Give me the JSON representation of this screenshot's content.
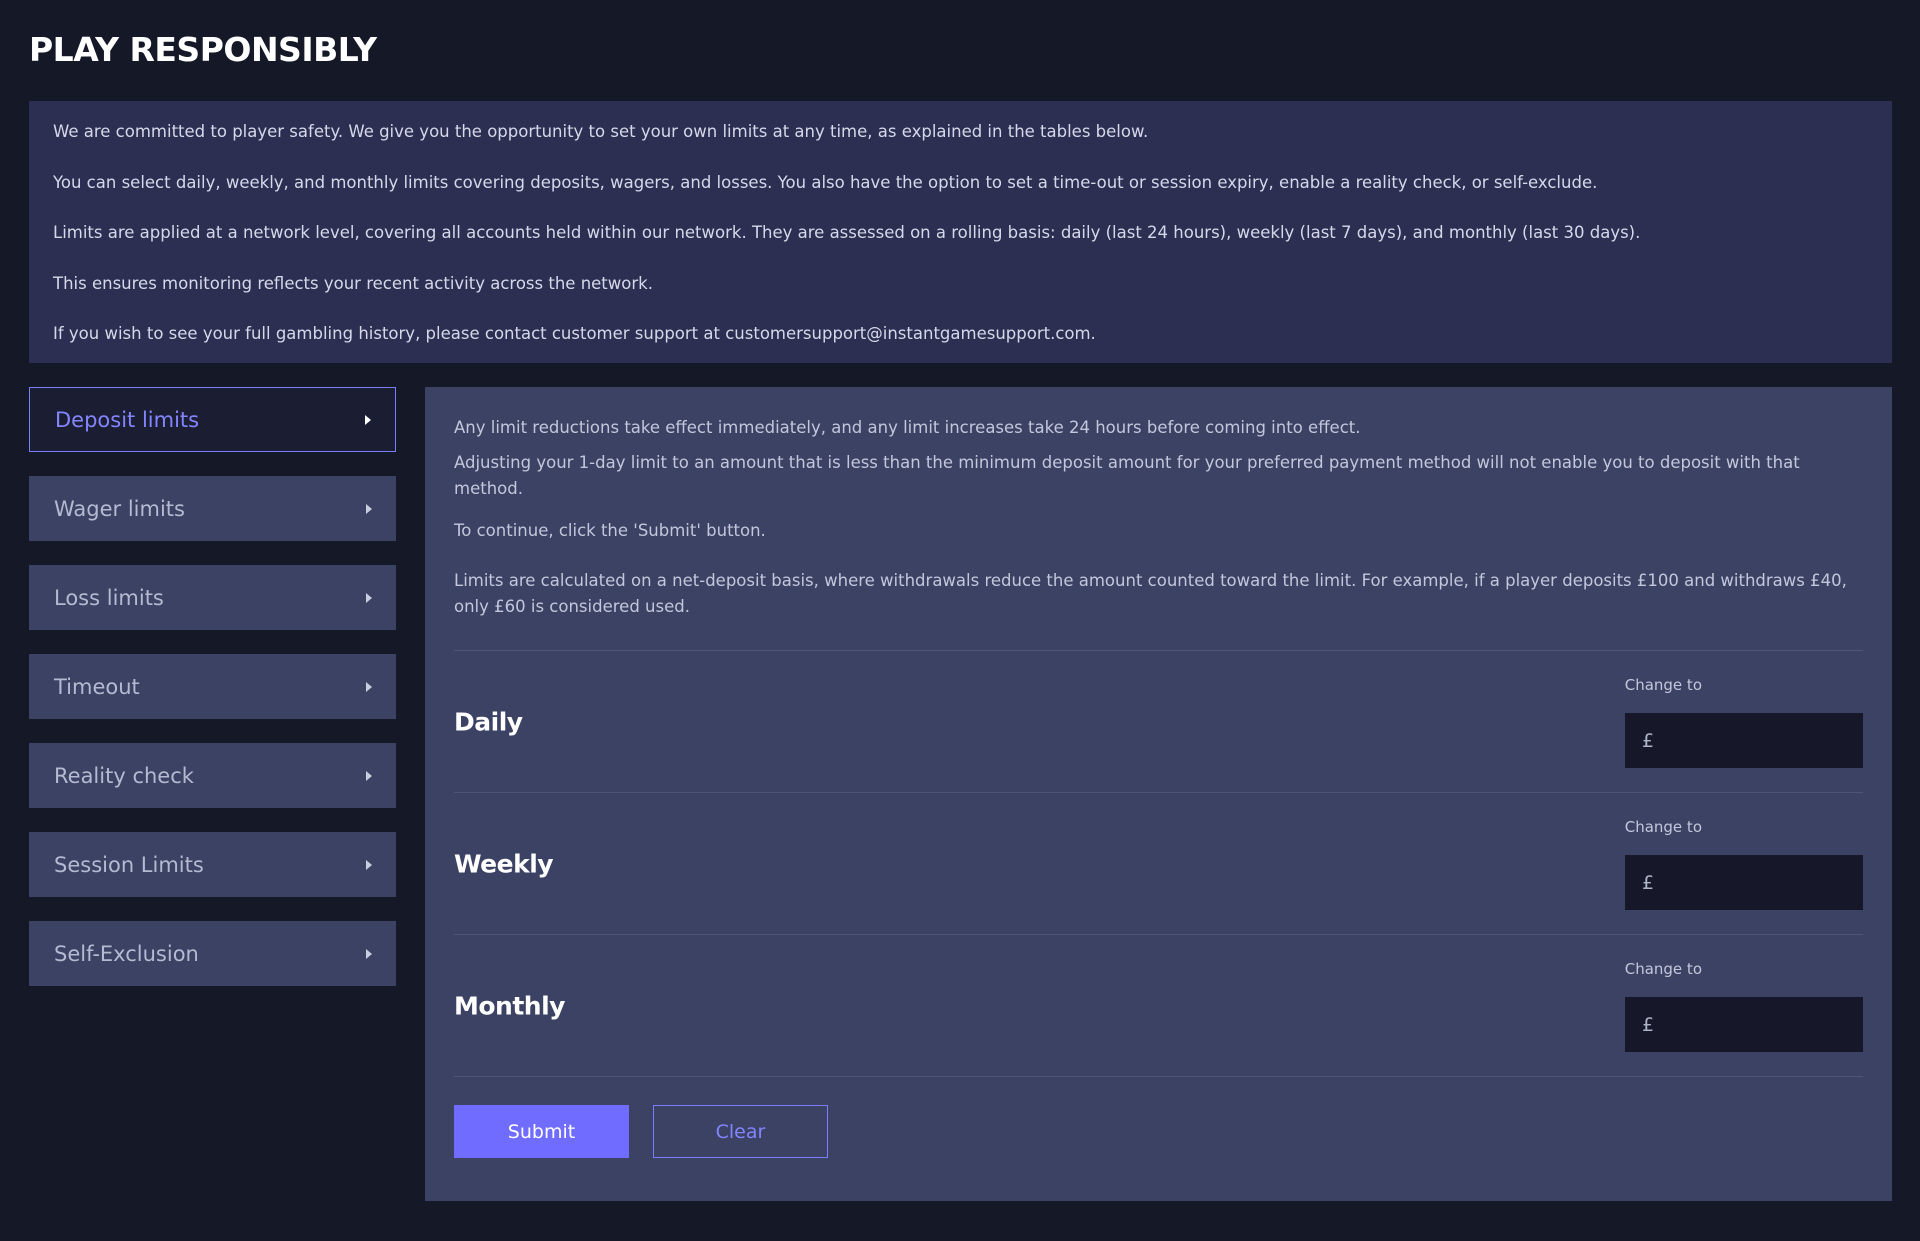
{
  "title": "PLAY RESPONSIBLY",
  "intro": [
    "We are committed to player safety. We give you the opportunity to set your own limits at any time, as explained in the tables below.",
    "You can select daily, weekly, and monthly limits covering deposits, wagers, and losses. You also have the option to set a time-out or session expiry, enable a reality check, or self-exclude.",
    "Limits are applied at a network level, covering all accounts held within our network. They are assessed on a rolling basis: daily (last 24 hours), weekly (last 7 days), and monthly (last 30 days).",
    "This ensures monitoring reflects your recent activity across the network.",
    "If you wish to see your full gambling history, please contact customer support at customersupport@instantgamesupport.com."
  ],
  "sidebar": {
    "items": [
      {
        "label": "Deposit limits",
        "active": true
      },
      {
        "label": "Wager limits"
      },
      {
        "label": "Loss limits"
      },
      {
        "label": "Timeout"
      },
      {
        "label": "Reality check"
      },
      {
        "label": "Session Limits"
      },
      {
        "label": "Self-Exclusion"
      }
    ]
  },
  "panel": {
    "info": [
      "Any limit reductions take effect immediately, and any limit increases take 24 hours before coming into effect.",
      "Adjusting your 1-day limit to an amount that is less than the minimum deposit amount for your preferred payment method will not enable you to deposit with that method.",
      "To continue, click the 'Submit' button.",
      "Limits are calculated on a net-deposit basis, where withdrawals reduce the amount counted toward the limit. For example, if a player deposits £100 and withdraws £40, only £60 is considered used."
    ],
    "limits": [
      {
        "name": "Daily",
        "change_label": "Change to",
        "currency": "£",
        "value": ""
      },
      {
        "name": "Weekly",
        "change_label": "Change to",
        "currency": "£",
        "value": ""
      },
      {
        "name": "Monthly",
        "change_label": "Change to",
        "currency": "£",
        "value": ""
      }
    ],
    "submit_label": "Submit",
    "clear_label": "Clear"
  },
  "colors": {
    "background": "#151827",
    "intro_bg": "#2d2f52",
    "panel_bg": "#3b4263",
    "accent": "#6f6cff",
    "accent_text": "#8385ff"
  }
}
